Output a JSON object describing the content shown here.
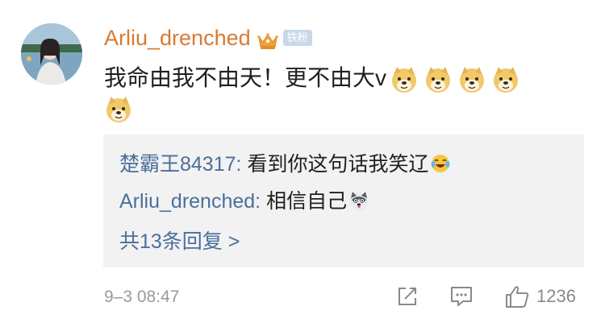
{
  "comment": {
    "username": "Arliu_drenched",
    "badge_icon": "crown-icon",
    "fan_badge": "铁粉",
    "text": "我命由我不由天！更不由大v",
    "emojis": [
      "doge-emoji",
      "doge-emoji",
      "doge-emoji",
      "doge-emoji",
      "doge-emoji"
    ],
    "timestamp": "9–3 08:47",
    "like_count": "1236"
  },
  "replies": [
    {
      "author": "楚霸王84317",
      "separator": ": ",
      "text": "看到你这句话我笑辽",
      "emoji": "laughing-tears-emoji"
    },
    {
      "author": "Arliu_drenched",
      "separator": ": ",
      "text": "相信自己",
      "emoji": "husky-emoji"
    }
  ],
  "more_replies": "共13条回复 >",
  "colors": {
    "username": "#d87a32",
    "reply_author": "#4a6f9c",
    "reply_bg": "#f2f2f2",
    "meta": "#9a9a9a"
  }
}
